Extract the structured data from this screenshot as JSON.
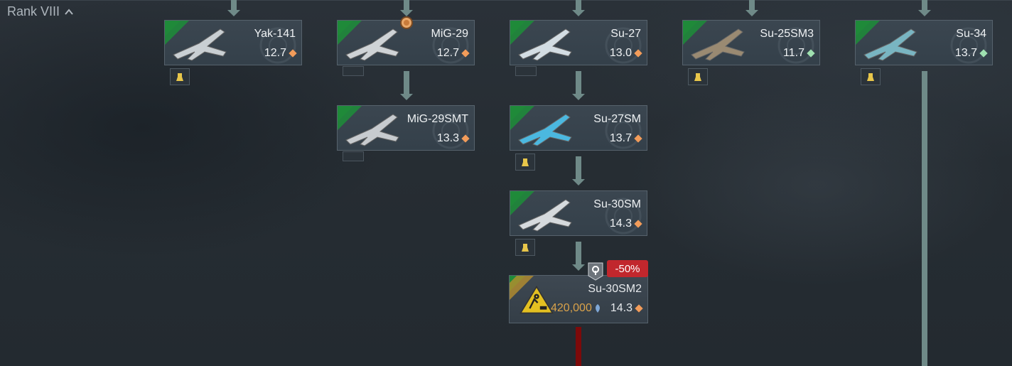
{
  "rank": {
    "label": "Rank VIII"
  },
  "colors": {
    "accent_orange": "#f29c5a",
    "accent_green": "#9fe0b0",
    "connector": "#6f8a88",
    "discount_red": "#c1272d",
    "cost_gold": "#d9a24a"
  },
  "vehicles": [
    {
      "name": "Yak-141",
      "br": "12.7",
      "diamond": "orange",
      "icon": "aircraft-yak141-icon"
    },
    {
      "name": "MiG-29",
      "br": "12.7",
      "diamond": "orange",
      "icon": "aircraft-mig29-icon"
    },
    {
      "name": "Su-27",
      "br": "13.0",
      "diamond": "orange",
      "icon": "aircraft-su27-icon"
    },
    {
      "name": "Su-25SM3",
      "br": "11.7",
      "diamond": "green",
      "icon": "aircraft-su25sm3-icon"
    },
    {
      "name": "Su-34",
      "br": "13.7",
      "diamond": "green",
      "icon": "aircraft-su34-icon"
    },
    {
      "name": "MiG-29SMT",
      "br": "13.3",
      "diamond": "orange",
      "icon": "aircraft-mig29smt-icon"
    },
    {
      "name": "Su-27SM",
      "br": "13.7",
      "diamond": "orange",
      "icon": "aircraft-su27sm-icon"
    },
    {
      "name": "Su-30SM",
      "br": "14.3",
      "diamond": "orange",
      "icon": "aircraft-su30sm-icon"
    }
  ],
  "research": {
    "name": "Su-30SM2",
    "br": "14.3",
    "cost": "420,000",
    "discount": "-50%",
    "diamond": "orange",
    "icon": "under-construction-icon"
  }
}
